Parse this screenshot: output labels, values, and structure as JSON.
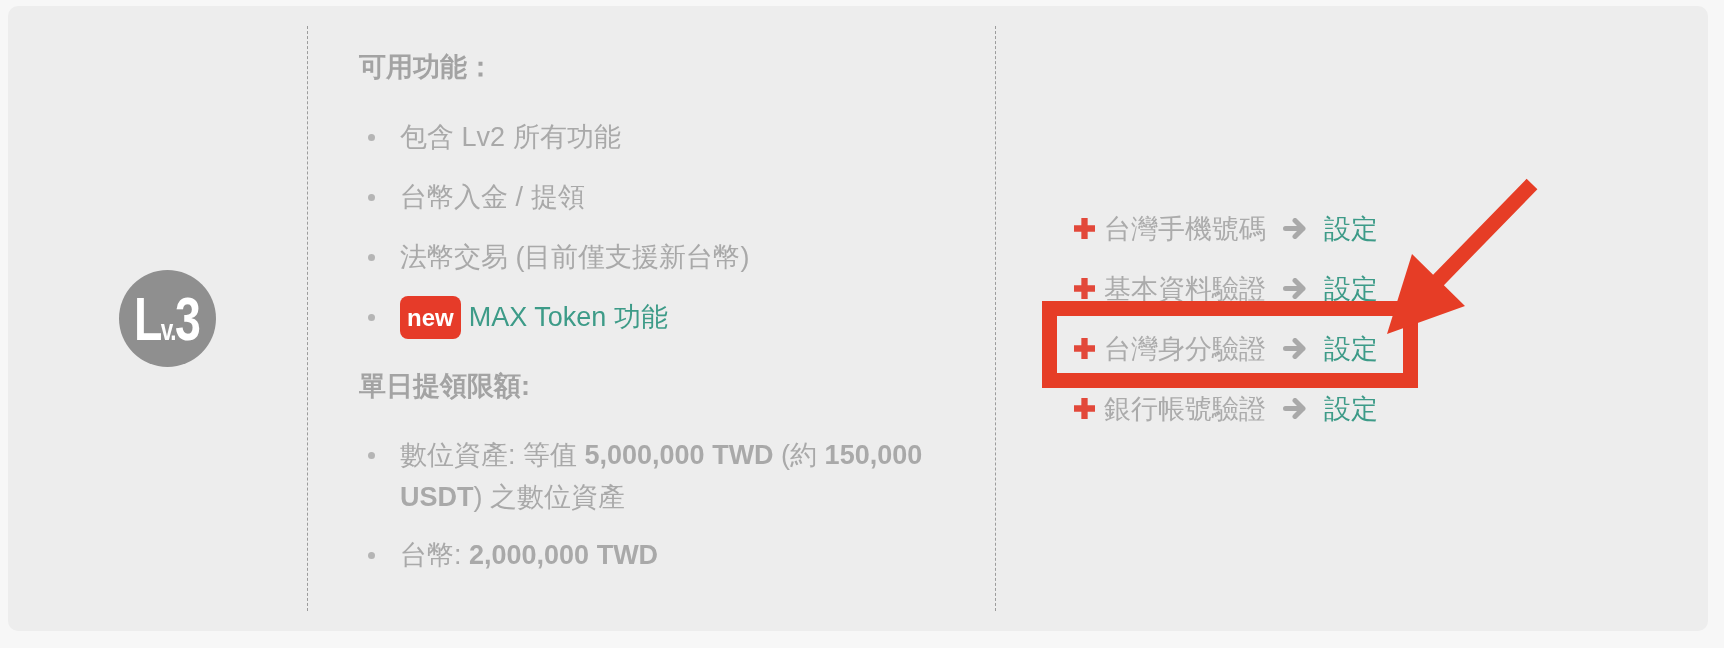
{
  "level_badge": {
    "text": "L$_{v.}$3"
  },
  "features": {
    "heading": "可用功能：",
    "items": [
      {
        "kind": "plain",
        "text": "包含 Lv2 所有功能"
      },
      {
        "kind": "plain",
        "text": "台幣入金 / 提領"
      },
      {
        "kind": "plain",
        "text": "法幣交易 (目前僅支援新台幣)"
      },
      {
        "kind": "link",
        "badge": "new",
        "text": "MAX Token 功能"
      }
    ]
  },
  "withdrawal_limits": {
    "heading": "單日提領限額:",
    "items": [
      "數位資產: 等值 **5,000,000 TWD** (約 **150,000 USDT**) 之數位資產",
      "台幣: **2,000,000 TWD**"
    ]
  },
  "requirements": [
    {
      "label": "台灣手機號碼",
      "action": "設定",
      "highlighted": false
    },
    {
      "label": "基本資料驗證",
      "action": "設定",
      "highlighted": false
    },
    {
      "label": "台灣身分驗證",
      "action": "設定",
      "highlighted": true
    },
    {
      "label": "銀行帳號驗證",
      "action": "設定",
      "highlighted": false
    }
  ]
}
